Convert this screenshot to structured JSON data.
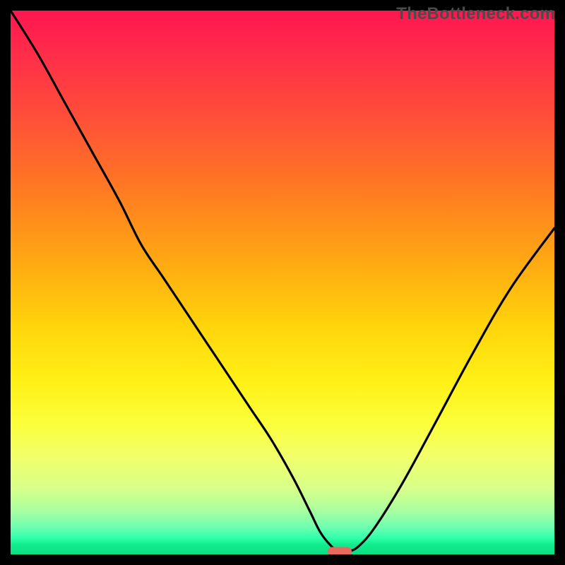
{
  "watermark": "TheBottleneck.com",
  "colors": {
    "curve": "#000000",
    "marker": "#e9695f",
    "frame": "#000000"
  },
  "chart_data": {
    "type": "line",
    "title": "",
    "xlabel": "",
    "ylabel": "",
    "xlim": [
      0,
      100
    ],
    "ylim": [
      0,
      100
    ],
    "grid": false,
    "legend": false,
    "gradient_axis": "y",
    "series": [
      {
        "name": "bottleneck-curve",
        "x": [
          0,
          5,
          10,
          15,
          20,
          24,
          28,
          32,
          36,
          40,
          44,
          48,
          52,
          55,
          57,
          59,
          60.5,
          62,
          64,
          67,
          72,
          78,
          85,
          92,
          100
        ],
        "y": [
          100,
          92,
          83,
          74,
          65,
          57,
          51,
          45,
          39,
          33,
          27,
          21,
          14,
          8,
          4,
          1.5,
          0.5,
          0.5,
          1.5,
          5,
          13,
          24,
          37,
          49,
          60
        ]
      }
    ],
    "valley_marker": {
      "x": 60.5,
      "y": 0.5
    }
  }
}
